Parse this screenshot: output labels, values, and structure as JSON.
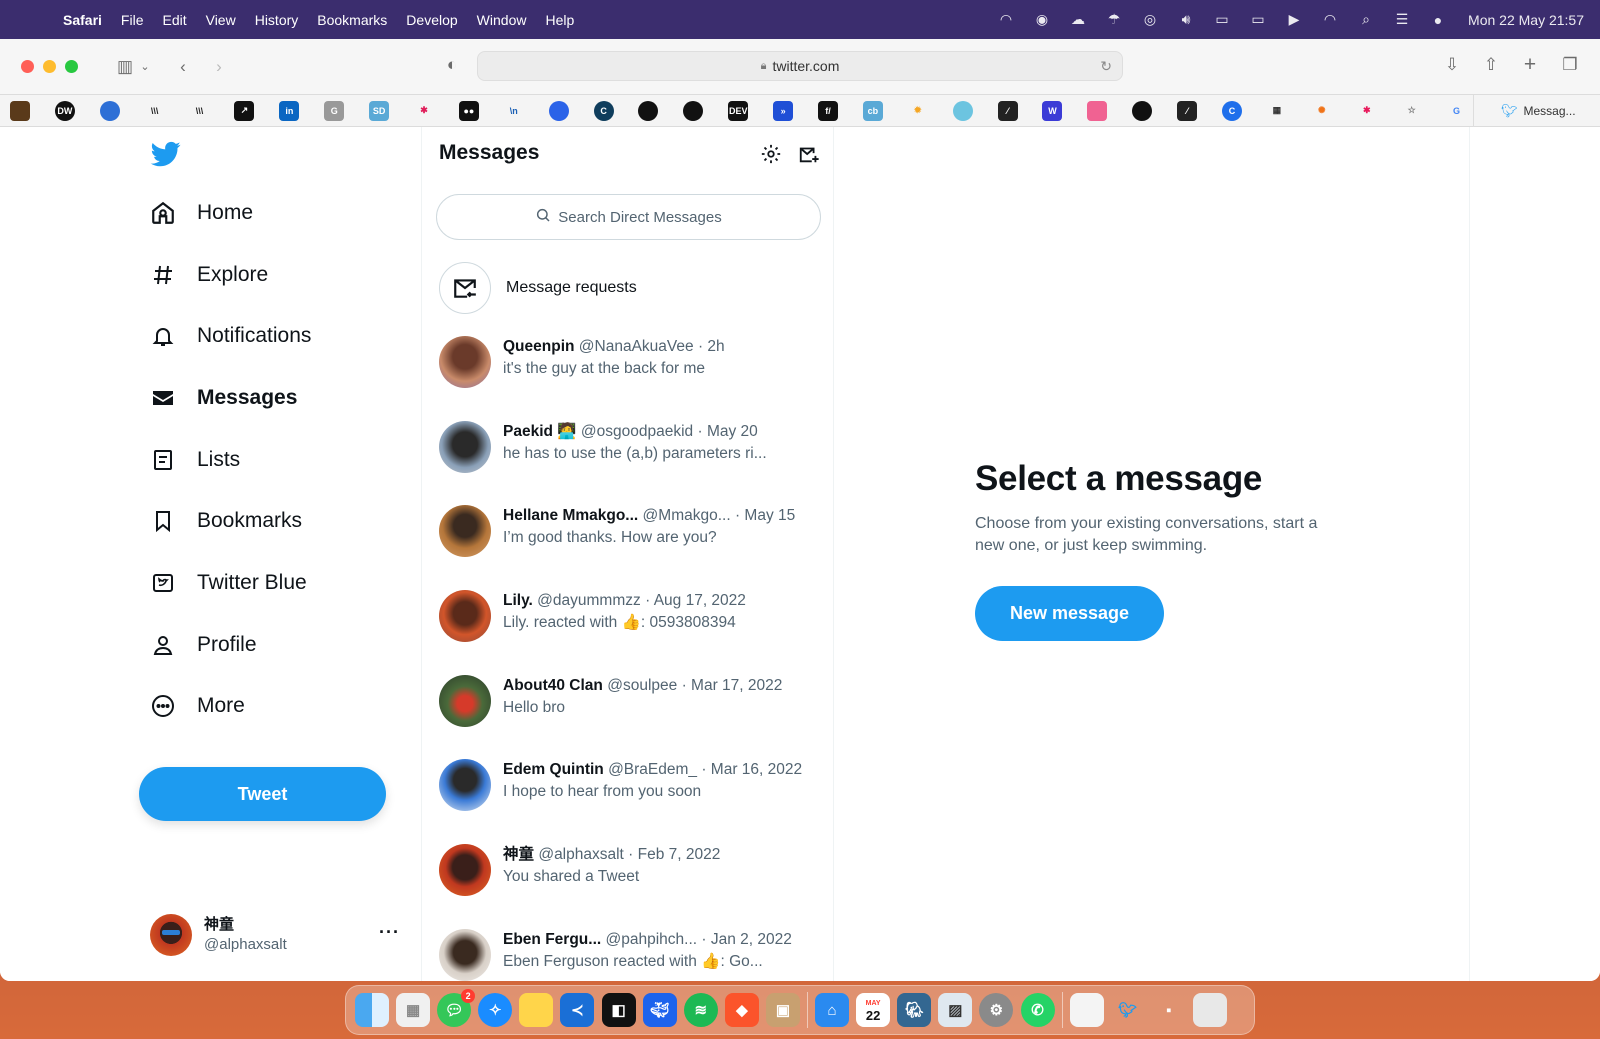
{
  "menubar": {
    "app_name": "Safari",
    "items": [
      "File",
      "Edit",
      "View",
      "History",
      "Bookmarks",
      "Develop",
      "Window",
      "Help"
    ],
    "clock": "Mon 22 May  21:57"
  },
  "browser": {
    "url": "twitter.com",
    "tab_title": "Messag..."
  },
  "sidebar": {
    "items": [
      {
        "label": "Home",
        "icon": "home-icon"
      },
      {
        "label": "Explore",
        "icon": "hashtag-icon"
      },
      {
        "label": "Notifications",
        "icon": "bell-icon"
      },
      {
        "label": "Messages",
        "icon": "envelope-icon"
      },
      {
        "label": "Lists",
        "icon": "list-icon"
      },
      {
        "label": "Bookmarks",
        "icon": "bookmark-icon"
      },
      {
        "label": "Twitter Blue",
        "icon": "twitter-blue-icon"
      },
      {
        "label": "Profile",
        "icon": "person-icon"
      },
      {
        "label": "More",
        "icon": "more-circle-icon"
      }
    ],
    "tweet_button": "Tweet",
    "account": {
      "name": "神童",
      "handle": "@alphaxsalt",
      "more": "···"
    }
  },
  "messages": {
    "title": "Messages",
    "search_placeholder": "Search Direct Messages",
    "requests_label": "Message requests",
    "conversations": [
      {
        "name": "Queenpin",
        "handle": "@NanaAkuaVee",
        "time": "· 2h",
        "preview": "it's the guy at the back for me"
      },
      {
        "name": "Paekid 🧑‍💻",
        "handle": "@osgoodpaekid",
        "time": "· May 20",
        "preview": "he has to use the (a,b) parameters ri..."
      },
      {
        "name": "Hellane Mmakgo...",
        "handle": "@Mmakgo...",
        "time": "· May 15",
        "preview": "I’m good thanks. How are you?"
      },
      {
        "name": "Lily.",
        "handle": "@dayummmzz",
        "time": "· Aug 17, 2022",
        "preview": "Lily. reacted with 👍: 0593808394"
      },
      {
        "name": "About40 Clan",
        "handle": "@soulpee",
        "time": "· Mar 17, 2022",
        "preview": "Hello bro"
      },
      {
        "name": "Edem Quintin",
        "handle": "@BraEdem_",
        "time": "· Mar 16, 2022",
        "preview": "I hope to hear from you soon"
      },
      {
        "name": "神童",
        "handle": "@alphaxsalt",
        "time": "· Feb 7, 2022",
        "preview": "You shared a Tweet"
      },
      {
        "name": "Eben Fergu...",
        "handle": "@pahpihch...",
        "time": "· Jan 2, 2022",
        "preview": "Eben Ferguson reacted with 👍: Go..."
      }
    ]
  },
  "detail": {
    "heading": "Select a message",
    "subtext": "Choose from your existing conversations, start a new one, or just keep swimming.",
    "button": "New message"
  },
  "dock": {
    "messages_badge": "2",
    "calendar_month": "MAY",
    "calendar_day": "22"
  },
  "colors": {
    "twitter_blue": "#1d9bf0",
    "text_primary": "#0f1419",
    "text_secondary": "#536471",
    "menubar": "#3b2d6e"
  }
}
